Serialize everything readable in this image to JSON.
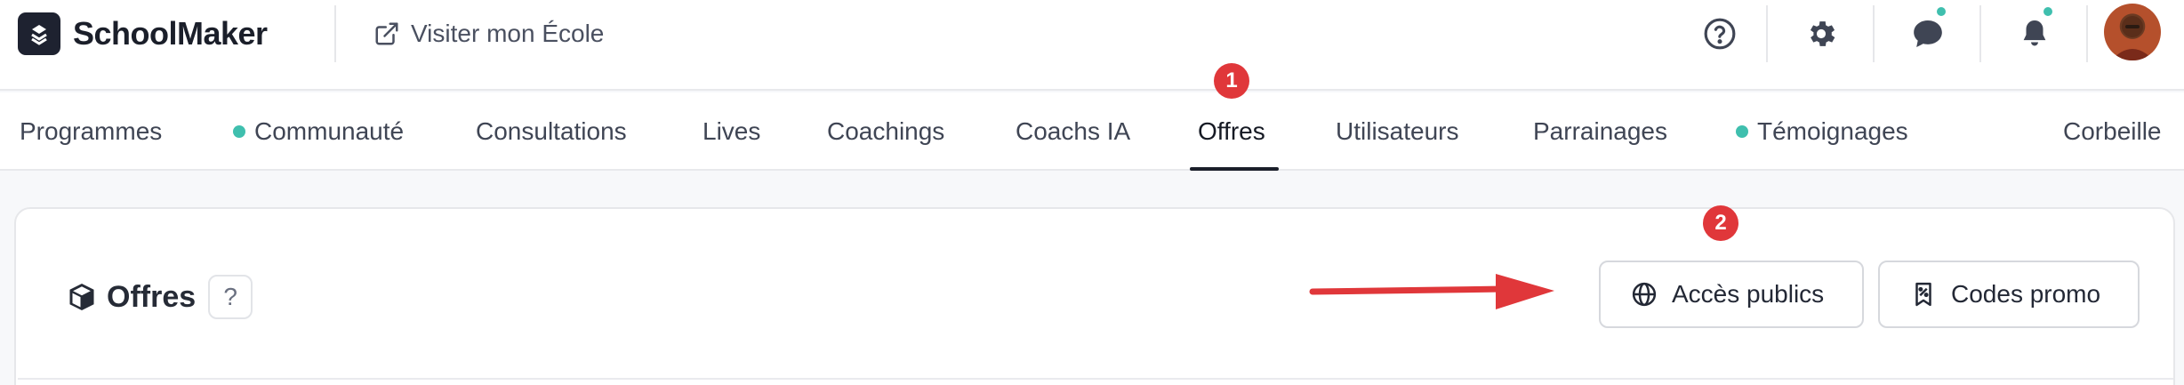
{
  "header": {
    "brand": "SchoolMaker",
    "visit_link": "Visiter mon École",
    "icons": [
      "help-circle-icon",
      "gear-icon",
      "chat-bubble-icon",
      "bell-icon"
    ]
  },
  "nav": {
    "tabs": [
      {
        "label": "Programmes",
        "dot": false
      },
      {
        "label": "Communauté",
        "dot": true
      },
      {
        "label": "Consultations",
        "dot": false
      },
      {
        "label": "Lives",
        "dot": false
      },
      {
        "label": "Coachings",
        "dot": false
      },
      {
        "label": "Coachs IA",
        "dot": false
      },
      {
        "label": "Offres",
        "dot": false,
        "active": true
      },
      {
        "label": "Utilisateurs",
        "dot": false
      },
      {
        "label": "Parrainages",
        "dot": false
      },
      {
        "label": "Témoignages",
        "dot": true
      },
      {
        "label": "Corbeille",
        "dot": false
      }
    ]
  },
  "annotations": {
    "badge1": "1",
    "badge2": "2",
    "color": "#e0373a"
  },
  "page": {
    "title": "Offres",
    "help": "?",
    "buttons": {
      "public_access": "Accès publics",
      "promo_codes": "Codes promo"
    }
  },
  "colors": {
    "accent_dot": "#3fbfae",
    "brand_dark": "#1e2230"
  }
}
